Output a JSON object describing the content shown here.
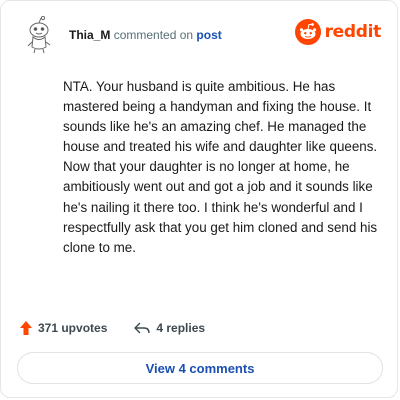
{
  "header": {
    "username": "Thia_M",
    "action_text": "commented on",
    "post_link": "post",
    "brand": "reddit"
  },
  "comment": {
    "body": "NTA. Your husband is quite ambitious. He has mastered being a handyman and fixing the house. It sounds like he's an amazing chef. He managed the house and treated his wife and daughter like queens. Now that your daughter is no longer at home, he ambitiously went out and got a job and it sounds like he's nailing it there too. I think he's wonderful and I respectfully ask that you get him cloned and send his clone to me."
  },
  "actions": {
    "upvotes": "371 upvotes",
    "replies": "4 replies"
  },
  "footer": {
    "view_button": "View 4 comments"
  },
  "colors": {
    "brand": "#ff4500",
    "link": "#1a4fb3"
  },
  "icons": {
    "avatar": "snoo-avatar-icon",
    "logo": "reddit-logo-icon",
    "upvote": "upvote-arrow-icon",
    "reply": "reply-arrow-icon"
  }
}
